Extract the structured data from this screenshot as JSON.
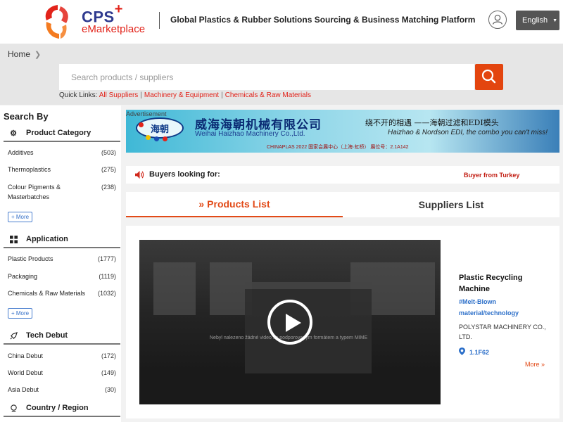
{
  "header": {
    "logo_cps": "CPS",
    "logo_plus": "+",
    "logo_emarketplace": "eMarketplace",
    "tagline": "Global Plastics & Rubber Solutions Sourcing & Business Matching Platform",
    "language": "English",
    "brand_colors": {
      "red": "#e2231a",
      "orange": "#f47b20",
      "navy": "#2f3a8f"
    }
  },
  "breadcrumb": {
    "home": "Home",
    "separator_icon": "chevron-right-icon"
  },
  "search": {
    "placeholder": "Search products / suppliers",
    "button_icon": "search-icon",
    "button_color": "#e3450f"
  },
  "quick_links": {
    "label": "Quick Links:",
    "links": [
      "All Suppliers",
      "Machinery & Equipment",
      "Chemicals & Raw Materials"
    ],
    "separator": "|"
  },
  "sidebar": {
    "title": "Search By",
    "product_category": {
      "title": "Product Category",
      "icon": "gear-icon",
      "items": [
        {
          "label": "Additives",
          "count": "(503)"
        },
        {
          "label": "Thermoplastics",
          "count": "(275)"
        },
        {
          "label": "Colour Pigments & Masterbatches",
          "count": "(238)"
        }
      ],
      "more": "+ More"
    },
    "application": {
      "title": "Application",
      "icon": "grid-icon",
      "items": [
        {
          "label": "Plastic Products",
          "count": "(1777)"
        },
        {
          "label": "Packaging",
          "count": "(1119)"
        },
        {
          "label": "Chemicals & Raw Materials",
          "count": "(1032)"
        }
      ],
      "more": "+ More"
    },
    "tech_debut": {
      "title": "Tech Debut",
      "icon": "rocket-icon",
      "items": [
        {
          "label": "China Debut",
          "count": "(172)"
        },
        {
          "label": "World Debut",
          "count": "(149)"
        },
        {
          "label": "Asia Debut",
          "count": "(30)"
        }
      ]
    },
    "country_region": {
      "title": "Country / Region",
      "icon": "globe-icon"
    }
  },
  "ad": {
    "label": "Advertisement",
    "logo_text": "海朝",
    "company_cn": "威海海朝机械有限公司",
    "company_en": "Weihai Haizhao Machinery Co.,Ltd.",
    "slogan_cn": "绕不开的相遇 ——海朝过滤和EDI模头",
    "slogan_en": "Haizhao & Nordson EDI, the combo you can't miss!",
    "booth_line": "CHINAPLAS 2022 国家会展中心（上海·虹桥） 展位号：2.1A142"
  },
  "buyers": {
    "icon": "speaker-icon",
    "label": "Buyers looking for:",
    "ticker": "Buyer from Turkey"
  },
  "tabs": {
    "products": "Products List",
    "products_prefix": "»",
    "suppliers": "Suppliers List"
  },
  "product": {
    "video_message": "Nebyl nalezeno žádné video se podporovaným formátem a typem MIME",
    "title": "Plastic Recycling Machine",
    "tag": "#Melt-Blown material/technology",
    "company": "POLYSTAR MACHINERY CO., LTD.",
    "booth": "1.1F62",
    "more": "More »"
  }
}
